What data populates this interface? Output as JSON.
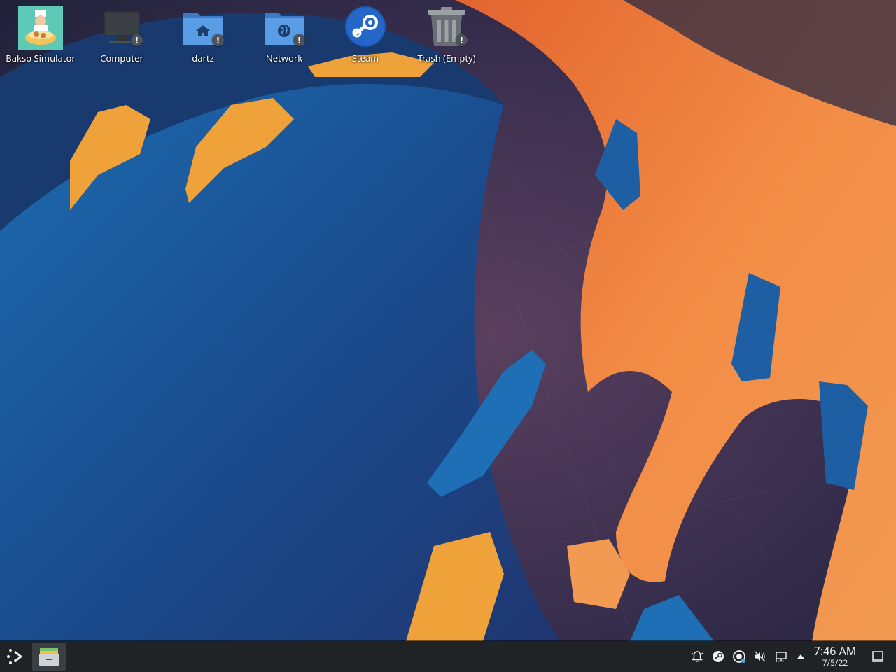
{
  "desktop": {
    "icons": [
      {
        "label": "Bakso Simulator",
        "icon": "game-icon"
      },
      {
        "label": "Computer",
        "icon": "computer-icon"
      },
      {
        "label": "dartz",
        "icon": "home-folder-icon"
      },
      {
        "label": "Network",
        "icon": "network-folder-icon"
      },
      {
        "label": "Steam",
        "icon": "steam-icon"
      },
      {
        "label": "Trash (Empty)",
        "icon": "trash-icon"
      }
    ]
  },
  "taskbar": {
    "launcher_icon": "application-launcher-icon",
    "task_icon": "file-manager-icon",
    "tray_icons": [
      "notifications-icon",
      "steam-tray-icon",
      "update-icon",
      "volume-muted-icon",
      "network-icon",
      "expand-tray-icon"
    ],
    "clock": {
      "time": "7:46 AM",
      "date": "7/5/22"
    }
  },
  "colors": {
    "wallpaper_blue": "#1f5fa0",
    "wallpaper_orange": "#f08a3c",
    "taskbar_bg": "#202326",
    "accent": "#3daee9"
  }
}
